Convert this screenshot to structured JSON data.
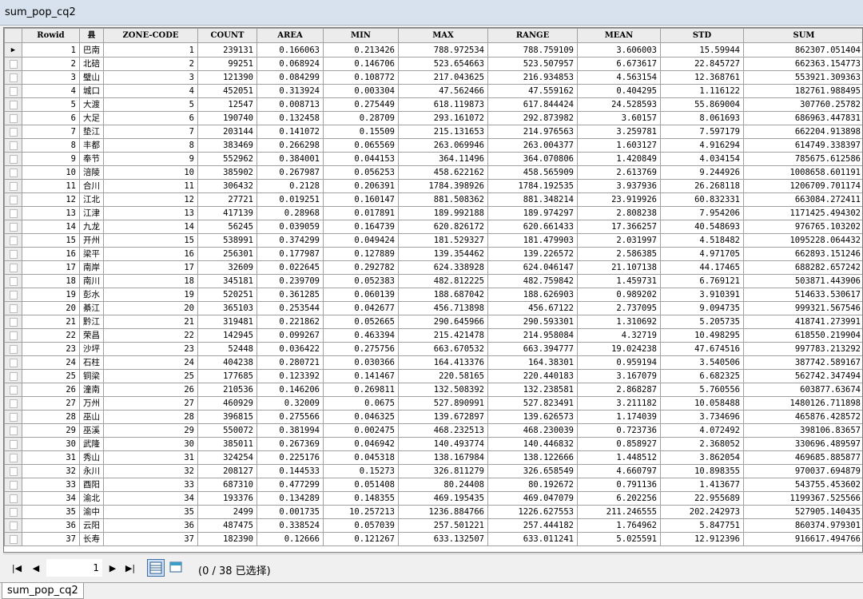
{
  "window": {
    "title": "sum_pop_cq2"
  },
  "table": {
    "columns": [
      "Rowid",
      "县",
      "ZONE-CODE",
      "COUNT",
      "AREA",
      "MIN",
      "MAX",
      "RANGE",
      "MEAN",
      "STD",
      "SUM"
    ],
    "rows": [
      [
        "1",
        "巴南",
        "1",
        "239131",
        "0.166063",
        "0.213426",
        "788.972534",
        "788.759109",
        "3.606003",
        "15.59944",
        "862307.051404"
      ],
      [
        "2",
        "北碚",
        "2",
        "99251",
        "0.068924",
        "0.146706",
        "523.654663",
        "523.507957",
        "6.673617",
        "22.845727",
        "662363.154773"
      ],
      [
        "3",
        "璧山",
        "3",
        "121390",
        "0.084299",
        "0.108772",
        "217.043625",
        "216.934853",
        "4.563154",
        "12.368761",
        "553921.309363"
      ],
      [
        "4",
        "城口",
        "4",
        "452051",
        "0.313924",
        "0.003304",
        "47.562466",
        "47.559162",
        "0.404295",
        "1.116122",
        "182761.988495"
      ],
      [
        "5",
        "大渡",
        "5",
        "12547",
        "0.008713",
        "0.275449",
        "618.119873",
        "617.844424",
        "24.528593",
        "55.869004",
        "307760.25782"
      ],
      [
        "6",
        "大足",
        "6",
        "190740",
        "0.132458",
        "0.28709",
        "293.161072",
        "292.873982",
        "3.60157",
        "8.061693",
        "686963.447831"
      ],
      [
        "7",
        "垫江",
        "7",
        "203144",
        "0.141072",
        "0.15509",
        "215.131653",
        "214.976563",
        "3.259781",
        "7.597179",
        "662204.913898"
      ],
      [
        "8",
        "丰都",
        "8",
        "383469",
        "0.266298",
        "0.065569",
        "263.069946",
        "263.004377",
        "1.603127",
        "4.916294",
        "614749.338397"
      ],
      [
        "9",
        "奉节",
        "9",
        "552962",
        "0.384001",
        "0.044153",
        "364.11496",
        "364.070806",
        "1.420849",
        "4.034154",
        "785675.612586"
      ],
      [
        "10",
        "涪陵",
        "10",
        "385902",
        "0.267987",
        "0.056253",
        "458.622162",
        "458.565909",
        "2.613769",
        "9.244926",
        "1008658.601191"
      ],
      [
        "11",
        "合川",
        "11",
        "306432",
        "0.2128",
        "0.206391",
        "1784.398926",
        "1784.192535",
        "3.937936",
        "26.268118",
        "1206709.701174"
      ],
      [
        "12",
        "江北",
        "12",
        "27721",
        "0.019251",
        "0.160147",
        "881.508362",
        "881.348214",
        "23.919926",
        "60.832331",
        "663084.272411"
      ],
      [
        "13",
        "江津",
        "13",
        "417139",
        "0.28968",
        "0.017891",
        "189.992188",
        "189.974297",
        "2.808238",
        "7.954206",
        "1171425.494302"
      ],
      [
        "14",
        "九龙",
        "14",
        "56245",
        "0.039059",
        "0.164739",
        "620.826172",
        "620.661433",
        "17.366257",
        "40.548693",
        "976765.103202"
      ],
      [
        "15",
        "开州",
        "15",
        "538991",
        "0.374299",
        "0.049424",
        "181.529327",
        "181.479903",
        "2.031997",
        "4.518482",
        "1095228.064432"
      ],
      [
        "16",
        "梁平",
        "16",
        "256301",
        "0.177987",
        "0.127889",
        "139.354462",
        "139.226572",
        "2.586385",
        "4.971705",
        "662893.151246"
      ],
      [
        "17",
        "南岸",
        "17",
        "32609",
        "0.022645",
        "0.292782",
        "624.338928",
        "624.046147",
        "21.107138",
        "44.17465",
        "688282.657242"
      ],
      [
        "18",
        "南川",
        "18",
        "345181",
        "0.239709",
        "0.052383",
        "482.812225",
        "482.759842",
        "1.459731",
        "6.769121",
        "503871.443906"
      ],
      [
        "19",
        "彭水",
        "19",
        "520251",
        "0.361285",
        "0.060139",
        "188.687042",
        "188.626903",
        "0.989202",
        "3.910391",
        "514633.530617"
      ],
      [
        "20",
        "綦江",
        "20",
        "365103",
        "0.253544",
        "0.042677",
        "456.713898",
        "456.67122",
        "2.737095",
        "9.094735",
        "999321.567546"
      ],
      [
        "21",
        "黔江",
        "21",
        "319481",
        "0.221862",
        "0.052665",
        "290.645966",
        "290.593301",
        "1.310692",
        "5.205735",
        "418741.273991"
      ],
      [
        "22",
        "荣昌",
        "22",
        "142945",
        "0.099267",
        "0.463394",
        "215.421478",
        "214.958084",
        "4.32719",
        "10.498295",
        "618550.219904"
      ],
      [
        "23",
        "沙坪",
        "23",
        "52448",
        "0.036422",
        "0.275756",
        "663.670532",
        "663.394777",
        "19.024238",
        "47.674516",
        "997783.213292"
      ],
      [
        "24",
        "石柱",
        "24",
        "404238",
        "0.280721",
        "0.030366",
        "164.413376",
        "164.38301",
        "0.959194",
        "3.540506",
        "387742.589167"
      ],
      [
        "25",
        "铜梁",
        "25",
        "177685",
        "0.123392",
        "0.141467",
        "220.58165",
        "220.440183",
        "3.167079",
        "6.682325",
        "562742.347494"
      ],
      [
        "26",
        "潼南",
        "26",
        "210536",
        "0.146206",
        "0.269811",
        "132.508392",
        "132.238581",
        "2.868287",
        "5.760556",
        "603877.63674"
      ],
      [
        "27",
        "万州",
        "27",
        "460929",
        "0.32009",
        "0.0675",
        "527.890991",
        "527.823491",
        "3.211182",
        "10.058488",
        "1480126.711898"
      ],
      [
        "28",
        "巫山",
        "28",
        "396815",
        "0.275566",
        "0.046325",
        "139.672897",
        "139.626573",
        "1.174039",
        "3.734696",
        "465876.428572"
      ],
      [
        "29",
        "巫溪",
        "29",
        "550072",
        "0.381994",
        "0.002475",
        "468.232513",
        "468.230039",
        "0.723736",
        "4.072492",
        "398106.83657"
      ],
      [
        "30",
        "武隆",
        "30",
        "385011",
        "0.267369",
        "0.046942",
        "140.493774",
        "140.446832",
        "0.858927",
        "2.368052",
        "330696.489597"
      ],
      [
        "31",
        "秀山",
        "31",
        "324254",
        "0.225176",
        "0.045318",
        "138.167984",
        "138.122666",
        "1.448512",
        "3.862054",
        "469685.885877"
      ],
      [
        "32",
        "永川",
        "32",
        "208127",
        "0.144533",
        "0.15273",
        "326.811279",
        "326.658549",
        "4.660797",
        "10.898355",
        "970037.694879"
      ],
      [
        "33",
        "酉阳",
        "33",
        "687310",
        "0.477299",
        "0.051408",
        "80.24408",
        "80.192672",
        "0.791136",
        "1.413677",
        "543755.453602"
      ],
      [
        "34",
        "渝北",
        "34",
        "193376",
        "0.134289",
        "0.148355",
        "469.195435",
        "469.047079",
        "6.202256",
        "22.955689",
        "1199367.525566"
      ],
      [
        "35",
        "渝中",
        "35",
        "2499",
        "0.001735",
        "10.257213",
        "1236.884766",
        "1226.627553",
        "211.246555",
        "202.242973",
        "527905.140435"
      ],
      [
        "36",
        "云阳",
        "36",
        "487475",
        "0.338524",
        "0.057039",
        "257.501221",
        "257.444182",
        "1.764962",
        "5.847751",
        "860374.979301"
      ],
      [
        "37",
        "长寿",
        "37",
        "182390",
        "0.12666",
        "0.121267",
        "633.132507",
        "633.011241",
        "5.025591",
        "12.912396",
        "916617.494766"
      ]
    ]
  },
  "navigation": {
    "first_icon": "first-record-icon",
    "prev_icon": "previous-record-icon",
    "current_record": "1",
    "next_icon": "next-record-icon",
    "last_icon": "last-record-icon",
    "status": "(0 / 38 已选择)"
  },
  "tab": {
    "label": "sum_pop_cq2"
  }
}
